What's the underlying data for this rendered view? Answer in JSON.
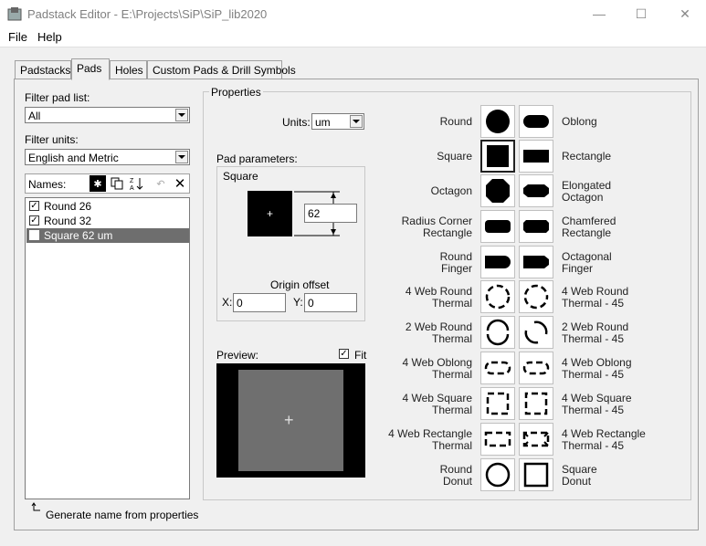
{
  "window": {
    "title": "Padstack Editor - E:\\Projects\\SiP\\SiP_lib2020",
    "minimize": "—",
    "maximize": "☐",
    "close": "✕"
  },
  "menu": [
    "File",
    "Help"
  ],
  "tabs": [
    "Padstacks",
    "Pads",
    "Holes",
    "Custom Pads & Drill Symbols"
  ],
  "left": {
    "filter_pad_label": "Filter pad list:",
    "filter_pad_value": "All",
    "filter_units_label": "Filter units:",
    "filter_units_value": "English and Metric",
    "names_label": "Names:",
    "items": [
      {
        "label": "Round 26",
        "checked": true,
        "selected": false
      },
      {
        "label": "Round 32",
        "checked": true,
        "selected": false
      },
      {
        "label": "Square 62 um",
        "checked": false,
        "selected": true
      }
    ],
    "generate_name": "Generate name from properties"
  },
  "properties": {
    "title": "Properties",
    "units_label": "Units:",
    "units_value": "um",
    "pad_params_label": "Pad parameters:",
    "shape_name": "Square",
    "size_value": "62",
    "origin_label": "Origin offset",
    "x_label": "X:",
    "x_value": "0",
    "y_label": "Y:",
    "y_value": "0",
    "preview_label": "Preview:",
    "fit_label": "Fit",
    "fit_checked": true
  },
  "shapes": [
    {
      "left": "Round",
      "right": "Oblong",
      "l_icon": "round-pad-icon",
      "r_icon": "oblong-pad-icon"
    },
    {
      "left": "Square",
      "right": "Rectangle",
      "l_icon": "square-pad-icon",
      "r_icon": "rectangle-pad-icon"
    },
    {
      "left": "Octagon",
      "right": "Elongated\nOctagon",
      "l_icon": "octagon-pad-icon",
      "r_icon": "elongated-octagon-pad-icon"
    },
    {
      "left": "Radius Corner\nRectangle",
      "right": "Chamfered\nRectangle",
      "l_icon": "radius-corner-rectangle-icon",
      "r_icon": "chamfered-rectangle-icon"
    },
    {
      "left": "Round\nFinger",
      "right": "Octagonal\nFinger",
      "l_icon": "round-finger-icon",
      "r_icon": "octagonal-finger-icon"
    },
    {
      "left": "4 Web Round\nThermal",
      "right": "4 Web Round\nThermal - 45",
      "l_icon": "4-web-round-thermal-icon",
      "r_icon": "4-web-round-thermal-45-icon"
    },
    {
      "left": "2 Web Round\nThermal",
      "right": "2 Web Round\nThermal - 45",
      "l_icon": "2-web-round-thermal-icon",
      "r_icon": "2-web-round-thermal-45-icon"
    },
    {
      "left": "4 Web Oblong\nThermal",
      "right": "4 Web Oblong\nThermal - 45",
      "l_icon": "4-web-oblong-thermal-icon",
      "r_icon": "4-web-oblong-thermal-45-icon"
    },
    {
      "left": "4 Web Square\nThermal",
      "right": "4 Web Square\nThermal - 45",
      "l_icon": "4-web-square-thermal-icon",
      "r_icon": "4-web-square-thermal-45-icon"
    },
    {
      "left": "4 Web Rectangle\nThermal",
      "right": "4 Web Rectangle\nThermal - 45",
      "l_icon": "4-web-rectangle-thermal-icon",
      "r_icon": "4-web-rectangle-thermal-45-icon"
    },
    {
      "left": "Round\nDonut",
      "right": "Square\nDonut",
      "l_icon": "round-donut-icon",
      "r_icon": "square-donut-icon"
    }
  ],
  "selected_shape": "Square"
}
